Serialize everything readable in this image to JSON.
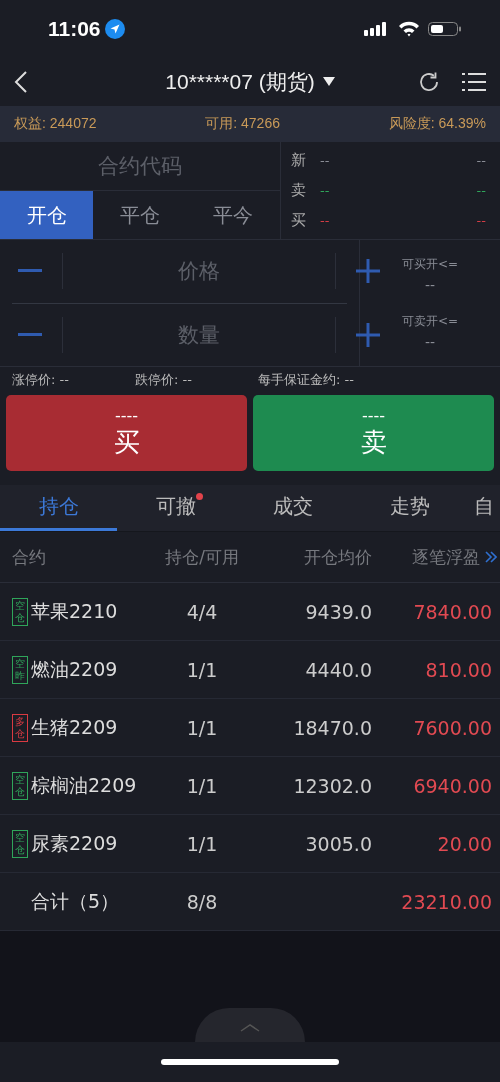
{
  "status_bar": {
    "time": "11:06"
  },
  "nav": {
    "title": "10*****07 (期货)"
  },
  "account": [
    {
      "label": "权益:",
      "value": "244072"
    },
    {
      "label": "可用:",
      "value": "47266"
    },
    {
      "label": "风险度:",
      "value": "64.39%"
    }
  ],
  "contract_field": {
    "placeholder": "合约代码"
  },
  "order_types": [
    {
      "label": "开仓",
      "selected": true
    },
    {
      "label": "平仓",
      "selected": false
    },
    {
      "label": "平今",
      "selected": false
    }
  ],
  "quotes": [
    {
      "label": "新",
      "kind": "last",
      "left": "--",
      "right": "--"
    },
    {
      "label": "卖",
      "kind": "ask",
      "left": "--",
      "right": "--"
    },
    {
      "label": "买",
      "kind": "bid",
      "left": "--",
      "right": "--"
    }
  ],
  "price_field": {
    "placeholder": "价格"
  },
  "quantity_field": {
    "placeholder": "数量"
  },
  "limits_side": [
    {
      "label": "可买开<=",
      "value": "--"
    },
    {
      "label": "可卖开<=",
      "value": "--"
    }
  ],
  "limits": [
    {
      "label": "涨停价:",
      "value": "--"
    },
    {
      "label": "跌停价:",
      "value": "--"
    },
    {
      "label": "每手保证金约:",
      "value": "--"
    }
  ],
  "buy_button": {
    "price": "----",
    "label": "买"
  },
  "sell_button": {
    "price": "----",
    "label": "卖"
  },
  "tabs": [
    {
      "label": "持仓",
      "selected": true,
      "badge": false
    },
    {
      "label": "可撤",
      "selected": false,
      "badge": true
    },
    {
      "label": "成交",
      "selected": false,
      "badge": false
    },
    {
      "label": "走势",
      "selected": false,
      "badge": false
    },
    {
      "label": "自",
      "selected": false,
      "badge": false
    }
  ],
  "table": {
    "columns": [
      "合约",
      "持仓/可用",
      "开仓均价",
      "逐笔浮盈"
    ],
    "rows": [
      {
        "tag": "空仓",
        "kind": "short",
        "name": "苹果2210",
        "position": "4/4",
        "avg_price": "9439.0",
        "pnl": "7840.00"
      },
      {
        "tag": "空昨",
        "kind": "short",
        "name": "燃油2209",
        "position": "1/1",
        "avg_price": "4440.0",
        "pnl": "810.00"
      },
      {
        "tag": "多仓",
        "kind": "long",
        "name": "生猪2209",
        "position": "1/1",
        "avg_price": "18470.0",
        "pnl": "7600.00"
      },
      {
        "tag": "空仓",
        "kind": "short",
        "name": "棕榈油2209",
        "position": "1/1",
        "avg_price": "12302.0",
        "pnl": "6940.00"
      },
      {
        "tag": "空仓",
        "kind": "short",
        "name": "尿素2209",
        "position": "1/1",
        "avg_price": "3005.0",
        "pnl": "20.00"
      }
    ],
    "total": {
      "label": "合计（5）",
      "position": "8/8",
      "pnl": "23210.00"
    }
  }
}
